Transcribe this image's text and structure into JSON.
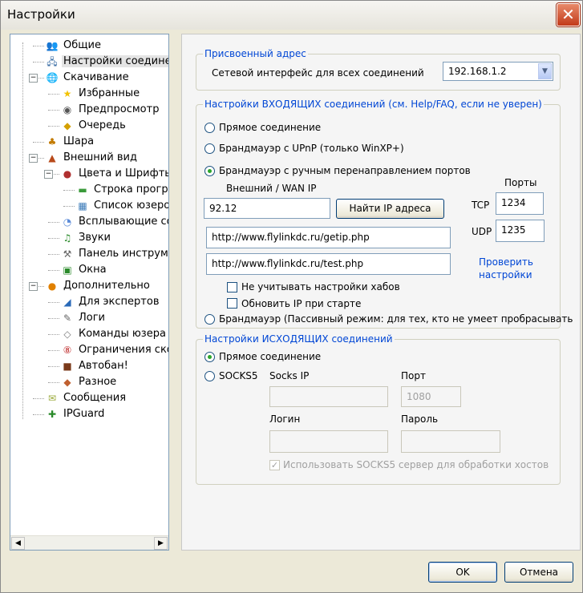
{
  "window": {
    "title": "Настройки",
    "close_glyph": "✕"
  },
  "tree": {
    "items": [
      {
        "label": "Общие",
        "icon": "people-icon"
      },
      {
        "label": "Настройки соединения",
        "icon": "network-icon"
      },
      {
        "label": "Скачивание",
        "icon": "download-globe-icon"
      },
      {
        "label": "Избранные",
        "icon": "star-icon"
      },
      {
        "label": "Предпросмотр",
        "icon": "preview-icon"
      },
      {
        "label": "Очередь",
        "icon": "queue-icon"
      },
      {
        "label": "Шара",
        "icon": "share-icon"
      },
      {
        "label": "Внешний вид",
        "icon": "appearance-icon"
      },
      {
        "label": "Цвета и Шрифты",
        "icon": "palette-icon"
      },
      {
        "label": "Строка прогресса",
        "icon": "progress-icon"
      },
      {
        "label": "Список юзеров",
        "icon": "users-icon"
      },
      {
        "label": "Всплывающие сообщ",
        "icon": "popup-icon"
      },
      {
        "label": "Звуки",
        "icon": "music-icon"
      },
      {
        "label": "Панель инструменто",
        "icon": "toolbar-icon"
      },
      {
        "label": "Окна",
        "icon": "windows-icon"
      },
      {
        "label": "Дополнительно",
        "icon": "advanced-icon"
      },
      {
        "label": "Для экспертов",
        "icon": "expert-icon"
      },
      {
        "label": "Логи",
        "icon": "log-icon"
      },
      {
        "label": "Команды юзера",
        "icon": "commands-icon"
      },
      {
        "label": "Ограничения скорос",
        "icon": "speed-limit-icon"
      },
      {
        "label": "Автобан!",
        "icon": "autoban-icon"
      },
      {
        "label": "Разное",
        "icon": "misc-icon"
      },
      {
        "label": "Сообщения",
        "icon": "messages-icon"
      },
      {
        "label": "IPGuard",
        "icon": "ipguard-icon"
      }
    ],
    "selected": "Настройки соединения"
  },
  "assigned": {
    "title": "Присвоенный адрес",
    "iface_label": "Сетевой интерфейс для всех соединений",
    "iface_value": "192.168.1.2"
  },
  "incoming": {
    "title": "Настройки ВХОДЯЩИХ соединений (см. Help/FAQ, если не уверен)",
    "opt_direct": "Прямое соединение",
    "opt_upnp": "Брандмауэр с UPnP (только WinXP+)",
    "opt_manual": "Брандмауэр с ручным перенаправлением портов",
    "wan_label": "Внешний / WAN IP",
    "wan_value": "92.12",
    "find_ip_button": "Найти IP адреса",
    "ports_label": "Порты",
    "tcp_label": "TCP",
    "tcp_value": "1234",
    "udp_label": "UDP",
    "udp_value": "1235",
    "getip_url": "http://www.flylinkdc.ru/getip.php",
    "test_url": "http://www.flylinkdc.ru/test.php",
    "check_link": "Проверить\nнастройки",
    "check_link_line1": "Проверить",
    "check_link_line2": "настройки",
    "ignore_hubs": "Не учитывать настройки хабов",
    "update_ip": "Обновить IP при старте",
    "opt_passive": "Брандмауэр (Пассивный режим: для тех, кто не умеет пробрасывать"
  },
  "outgoing": {
    "title": "Настройки ИСХОДЯЩИХ соединений",
    "opt_direct": "Прямое соединение",
    "opt_socks": "SOCKS5",
    "socks_ip_label": "Socks IP",
    "port_label": "Порт",
    "port_value": "1080",
    "login_label": "Логин",
    "password_label": "Пароль",
    "use_socks": "Использовать SOCKS5 сервер для обработки хостов"
  },
  "footer": {
    "ok": "OK",
    "cancel": "Отмена"
  }
}
